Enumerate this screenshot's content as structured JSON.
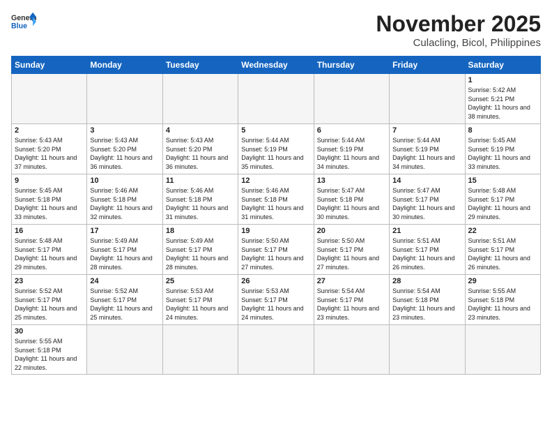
{
  "header": {
    "logo_general": "General",
    "logo_blue": "Blue",
    "title": "November 2025",
    "subtitle": "Culacling, Bicol, Philippines"
  },
  "weekdays": [
    "Sunday",
    "Monday",
    "Tuesday",
    "Wednesday",
    "Thursday",
    "Friday",
    "Saturday"
  ],
  "weeks": [
    [
      {
        "day": "",
        "info": ""
      },
      {
        "day": "",
        "info": ""
      },
      {
        "day": "",
        "info": ""
      },
      {
        "day": "",
        "info": ""
      },
      {
        "day": "",
        "info": ""
      },
      {
        "day": "",
        "info": ""
      },
      {
        "day": "1",
        "info": "Sunrise: 5:42 AM\nSunset: 5:21 PM\nDaylight: 11 hours\nand 38 minutes."
      }
    ],
    [
      {
        "day": "2",
        "info": "Sunrise: 5:43 AM\nSunset: 5:20 PM\nDaylight: 11 hours\nand 37 minutes."
      },
      {
        "day": "3",
        "info": "Sunrise: 5:43 AM\nSunset: 5:20 PM\nDaylight: 11 hours\nand 36 minutes."
      },
      {
        "day": "4",
        "info": "Sunrise: 5:43 AM\nSunset: 5:20 PM\nDaylight: 11 hours\nand 36 minutes."
      },
      {
        "day": "5",
        "info": "Sunrise: 5:44 AM\nSunset: 5:19 PM\nDaylight: 11 hours\nand 35 minutes."
      },
      {
        "day": "6",
        "info": "Sunrise: 5:44 AM\nSunset: 5:19 PM\nDaylight: 11 hours\nand 34 minutes."
      },
      {
        "day": "7",
        "info": "Sunrise: 5:44 AM\nSunset: 5:19 PM\nDaylight: 11 hours\nand 34 minutes."
      },
      {
        "day": "8",
        "info": "Sunrise: 5:45 AM\nSunset: 5:19 PM\nDaylight: 11 hours\nand 33 minutes."
      }
    ],
    [
      {
        "day": "9",
        "info": "Sunrise: 5:45 AM\nSunset: 5:18 PM\nDaylight: 11 hours\nand 33 minutes."
      },
      {
        "day": "10",
        "info": "Sunrise: 5:46 AM\nSunset: 5:18 PM\nDaylight: 11 hours\nand 32 minutes."
      },
      {
        "day": "11",
        "info": "Sunrise: 5:46 AM\nSunset: 5:18 PM\nDaylight: 11 hours\nand 31 minutes."
      },
      {
        "day": "12",
        "info": "Sunrise: 5:46 AM\nSunset: 5:18 PM\nDaylight: 11 hours\nand 31 minutes."
      },
      {
        "day": "13",
        "info": "Sunrise: 5:47 AM\nSunset: 5:18 PM\nDaylight: 11 hours\nand 30 minutes."
      },
      {
        "day": "14",
        "info": "Sunrise: 5:47 AM\nSunset: 5:17 PM\nDaylight: 11 hours\nand 30 minutes."
      },
      {
        "day": "15",
        "info": "Sunrise: 5:48 AM\nSunset: 5:17 PM\nDaylight: 11 hours\nand 29 minutes."
      }
    ],
    [
      {
        "day": "16",
        "info": "Sunrise: 5:48 AM\nSunset: 5:17 PM\nDaylight: 11 hours\nand 29 minutes."
      },
      {
        "day": "17",
        "info": "Sunrise: 5:49 AM\nSunset: 5:17 PM\nDaylight: 11 hours\nand 28 minutes."
      },
      {
        "day": "18",
        "info": "Sunrise: 5:49 AM\nSunset: 5:17 PM\nDaylight: 11 hours\nand 28 minutes."
      },
      {
        "day": "19",
        "info": "Sunrise: 5:50 AM\nSunset: 5:17 PM\nDaylight: 11 hours\nand 27 minutes."
      },
      {
        "day": "20",
        "info": "Sunrise: 5:50 AM\nSunset: 5:17 PM\nDaylight: 11 hours\nand 27 minutes."
      },
      {
        "day": "21",
        "info": "Sunrise: 5:51 AM\nSunset: 5:17 PM\nDaylight: 11 hours\nand 26 minutes."
      },
      {
        "day": "22",
        "info": "Sunrise: 5:51 AM\nSunset: 5:17 PM\nDaylight: 11 hours\nand 26 minutes."
      }
    ],
    [
      {
        "day": "23",
        "info": "Sunrise: 5:52 AM\nSunset: 5:17 PM\nDaylight: 11 hours\nand 25 minutes."
      },
      {
        "day": "24",
        "info": "Sunrise: 5:52 AM\nSunset: 5:17 PM\nDaylight: 11 hours\nand 25 minutes."
      },
      {
        "day": "25",
        "info": "Sunrise: 5:53 AM\nSunset: 5:17 PM\nDaylight: 11 hours\nand 24 minutes."
      },
      {
        "day": "26",
        "info": "Sunrise: 5:53 AM\nSunset: 5:17 PM\nDaylight: 11 hours\nand 24 minutes."
      },
      {
        "day": "27",
        "info": "Sunrise: 5:54 AM\nSunset: 5:17 PM\nDaylight: 11 hours\nand 23 minutes."
      },
      {
        "day": "28",
        "info": "Sunrise: 5:54 AM\nSunset: 5:18 PM\nDaylight: 11 hours\nand 23 minutes."
      },
      {
        "day": "29",
        "info": "Sunrise: 5:55 AM\nSunset: 5:18 PM\nDaylight: 11 hours\nand 23 minutes."
      }
    ],
    [
      {
        "day": "30",
        "info": "Sunrise: 5:55 AM\nSunset: 5:18 PM\nDaylight: 11 hours\nand 22 minutes."
      },
      {
        "day": "",
        "info": ""
      },
      {
        "day": "",
        "info": ""
      },
      {
        "day": "",
        "info": ""
      },
      {
        "day": "",
        "info": ""
      },
      {
        "day": "",
        "info": ""
      },
      {
        "day": "",
        "info": ""
      }
    ]
  ]
}
